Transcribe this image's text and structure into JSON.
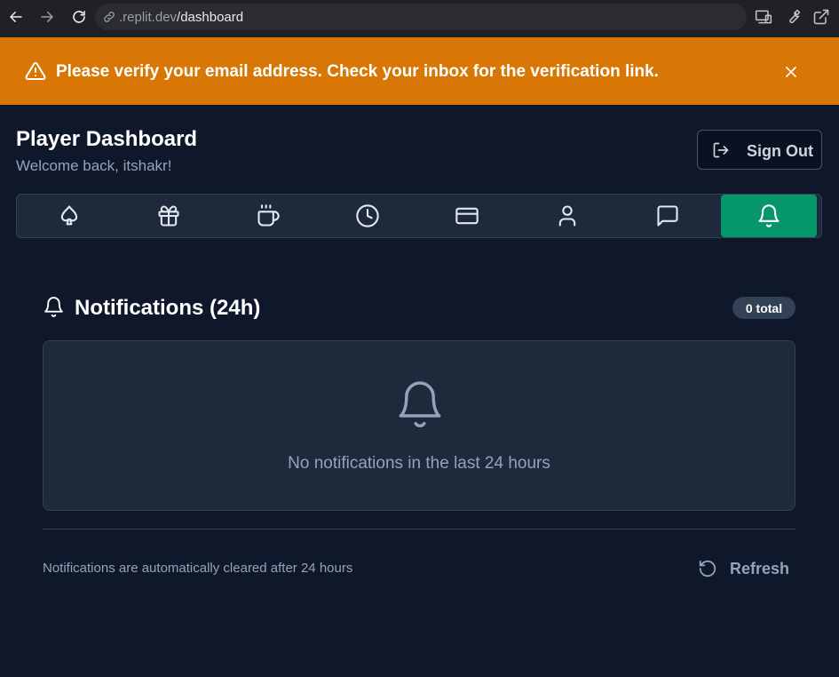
{
  "browser": {
    "url_host": ".replit.dev",
    "url_path": "/dashboard"
  },
  "banner": {
    "message": "Please verify your email address. Check your inbox for the verification link.",
    "icon": "warning-triangle-icon",
    "close_icon": "close-icon"
  },
  "header": {
    "title": "Player Dashboard",
    "welcome": "Welcome back, itshakr!",
    "sign_out_label": "Sign Out",
    "sign_out_icon": "sign-out-icon"
  },
  "tabs": [
    {
      "icon": "spade-icon",
      "active": false
    },
    {
      "icon": "gift-icon",
      "active": false
    },
    {
      "icon": "coffee-icon",
      "active": false
    },
    {
      "icon": "clock-icon",
      "active": false
    },
    {
      "icon": "credit-card-icon",
      "active": false
    },
    {
      "icon": "user-icon",
      "active": false
    },
    {
      "icon": "message-icon",
      "active": false
    },
    {
      "icon": "bell-icon",
      "active": true
    }
  ],
  "notifications": {
    "title": "Notifications (24h)",
    "count_badge": "0 total",
    "empty_message": "No notifications in the last 24 hours",
    "footer_note": "Notifications are automatically cleared after 24 hours",
    "refresh_label": "Refresh"
  },
  "colors": {
    "page_bg": "#0f172a",
    "banner_bg": "#d97706",
    "active_tab": "#059669",
    "card_bg": "#1e293b",
    "muted_text": "#94a3b8"
  }
}
